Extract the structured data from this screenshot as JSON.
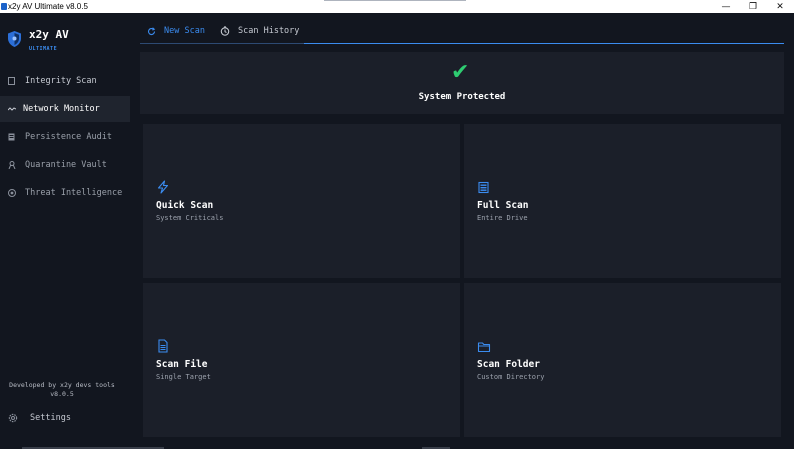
{
  "window": {
    "title": "x2y AV Ultimate v8.0.5",
    "minimize_glyph": "—",
    "maximize_glyph": "❐",
    "close_glyph": "✕"
  },
  "brand": {
    "name": "x2y AV",
    "subtitle": "ULTIMATE",
    "icon": "shield-icon"
  },
  "sidebar": {
    "items": [
      {
        "label": "Integrity Scan",
        "icon": "square-icon",
        "active": false
      },
      {
        "label": "Network Monitor",
        "icon": "pulse-icon",
        "active": true
      },
      {
        "label": "Persistence Audit",
        "icon": "document-icon",
        "active": false
      },
      {
        "label": "Quarantine Vault",
        "icon": "vault-icon",
        "active": false
      },
      {
        "label": "Threat Intelligence",
        "icon": "globe-icon",
        "active": false
      }
    ],
    "credit_line1": "Developed by x2y devs tools",
    "credit_line2": "v8.0.5",
    "settings_label": "Settings"
  },
  "tabs": [
    {
      "label": "New Scan",
      "icon": "refresh-icon",
      "active": true
    },
    {
      "label": "Scan History",
      "icon": "clock-icon",
      "active": false
    }
  ],
  "status": {
    "label": "System Protected",
    "icon": "check-icon",
    "color": "#2ecc71"
  },
  "scan_options": [
    {
      "title": "Quick Scan",
      "subtitle": "System Criticals",
      "icon": "lightning-icon"
    },
    {
      "title": "Full Scan",
      "subtitle": "Entire Drive",
      "icon": "drive-icon"
    },
    {
      "title": "Scan File",
      "subtitle": "Single Target",
      "icon": "file-icon"
    },
    {
      "title": "Scan Folder",
      "subtitle": "Custom Directory",
      "icon": "folder-icon"
    }
  ],
  "colors": {
    "accent": "#3b8cf0",
    "background": "#12161f",
    "card": "#1b1f29",
    "active_nav": "#1f242e",
    "success": "#2ecc71"
  }
}
